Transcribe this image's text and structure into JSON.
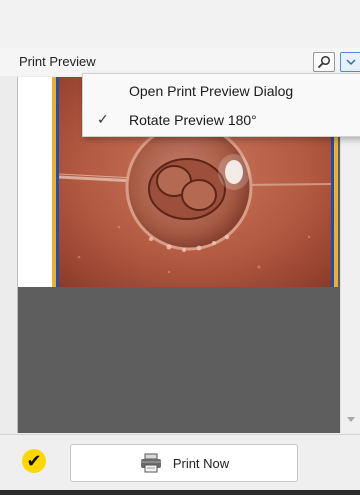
{
  "panel": {
    "title": "Print Preview"
  },
  "menu": {
    "items": [
      {
        "label": "Open Print Preview Dialog",
        "checked": false
      },
      {
        "label": "Rotate Preview 180°",
        "checked": true,
        "check_glyph": "✓"
      }
    ]
  },
  "bottom": {
    "status_glyph": "✔",
    "print_label": "Print Now"
  },
  "icons": {
    "search": "search-icon",
    "dropdown": "chevron-down-icon",
    "printer": "printer-icon",
    "status": "checkmark-icon"
  },
  "colors": {
    "status_yellow": "#ffd700",
    "dropdown_accent": "#4a90d9",
    "preview_background": "#5e5e5e",
    "page_border_gold": "#e3b23c",
    "page_border_blue": "#284e9c"
  }
}
